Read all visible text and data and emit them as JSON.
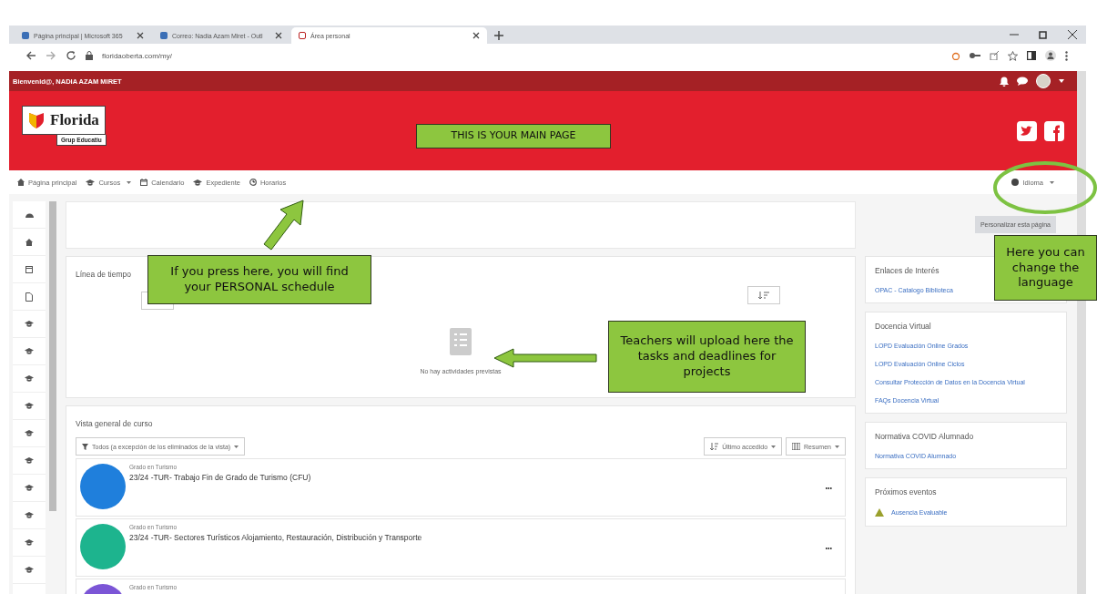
{
  "browser": {
    "tabs": [
      {
        "title": "Página principal | Microsoft 365",
        "selected": false
      },
      {
        "title": "Correo: Nadia Azam Miret - Outl",
        "selected": false
      },
      {
        "title": "Área personal",
        "selected": true
      }
    ],
    "url": "floridaoberta.com/my/"
  },
  "topbar": {
    "greeting": "Bienvenid@, NADIA AZAM MIRET"
  },
  "header": {
    "logo_name": "Florida",
    "logo_sub": "Grup Educatiu"
  },
  "nav": {
    "items": [
      {
        "label": "Página principal",
        "dropdown": false
      },
      {
        "label": "Cursos",
        "dropdown": true
      },
      {
        "label": "Calendario",
        "dropdown": false
      },
      {
        "label": "Expediente",
        "dropdown": false
      },
      {
        "label": "Horarios",
        "dropdown": false
      }
    ],
    "language": "Idioma"
  },
  "customize_button": "Personalizar esta página",
  "timeline": {
    "title": "Línea de tiempo",
    "empty_message": "No hay actividades previstas"
  },
  "course_overview": {
    "title": "Vista general de curso",
    "filter": "Todos (a excepción de los eliminados de la vista)",
    "sort": "Último accedido",
    "view": "Resumen",
    "courses": [
      {
        "category": "Grado en Turismo",
        "name": "23/24 -TUR- Trabajo Fin de Grado de Turismo (CFU)",
        "color": "#1f7fdc"
      },
      {
        "category": "Grado en Turismo",
        "name": "23/24 -TUR- Sectores Turísticos Alojamiento, Restauración, Distribución y Transporte",
        "color": "#1db48e"
      },
      {
        "category": "Grado en Turismo",
        "color": "#7b55d6"
      }
    ]
  },
  "blocks": [
    {
      "title": "Enlaces de Interés",
      "links": [
        "OPAC - Catalogo Biblioteca"
      ]
    },
    {
      "title": "Docencia Virtual",
      "links": [
        "LOPD Evaluación Online Grados",
        "LOPD Evaluación Online Ciclos",
        "Consultar Protección de Datos en la Docencia Virtual",
        "FAQs Docencia Virtual"
      ]
    },
    {
      "title": "Normativa COVID Alumnado",
      "links": [
        "Normativa COVID Alumnado"
      ]
    },
    {
      "title": "Próximos eventos",
      "events": [
        "Ausencia Evaluable"
      ]
    }
  ],
  "annotations": [
    {
      "text": "THIS IS YOUR MAIN PAGE"
    },
    {
      "text": "If you press here, you will find your PERSONAL schedule"
    },
    {
      "text": "Teachers will upload here the tasks and deadlines for projects"
    },
    {
      "text": "Here you can change the language"
    }
  ]
}
